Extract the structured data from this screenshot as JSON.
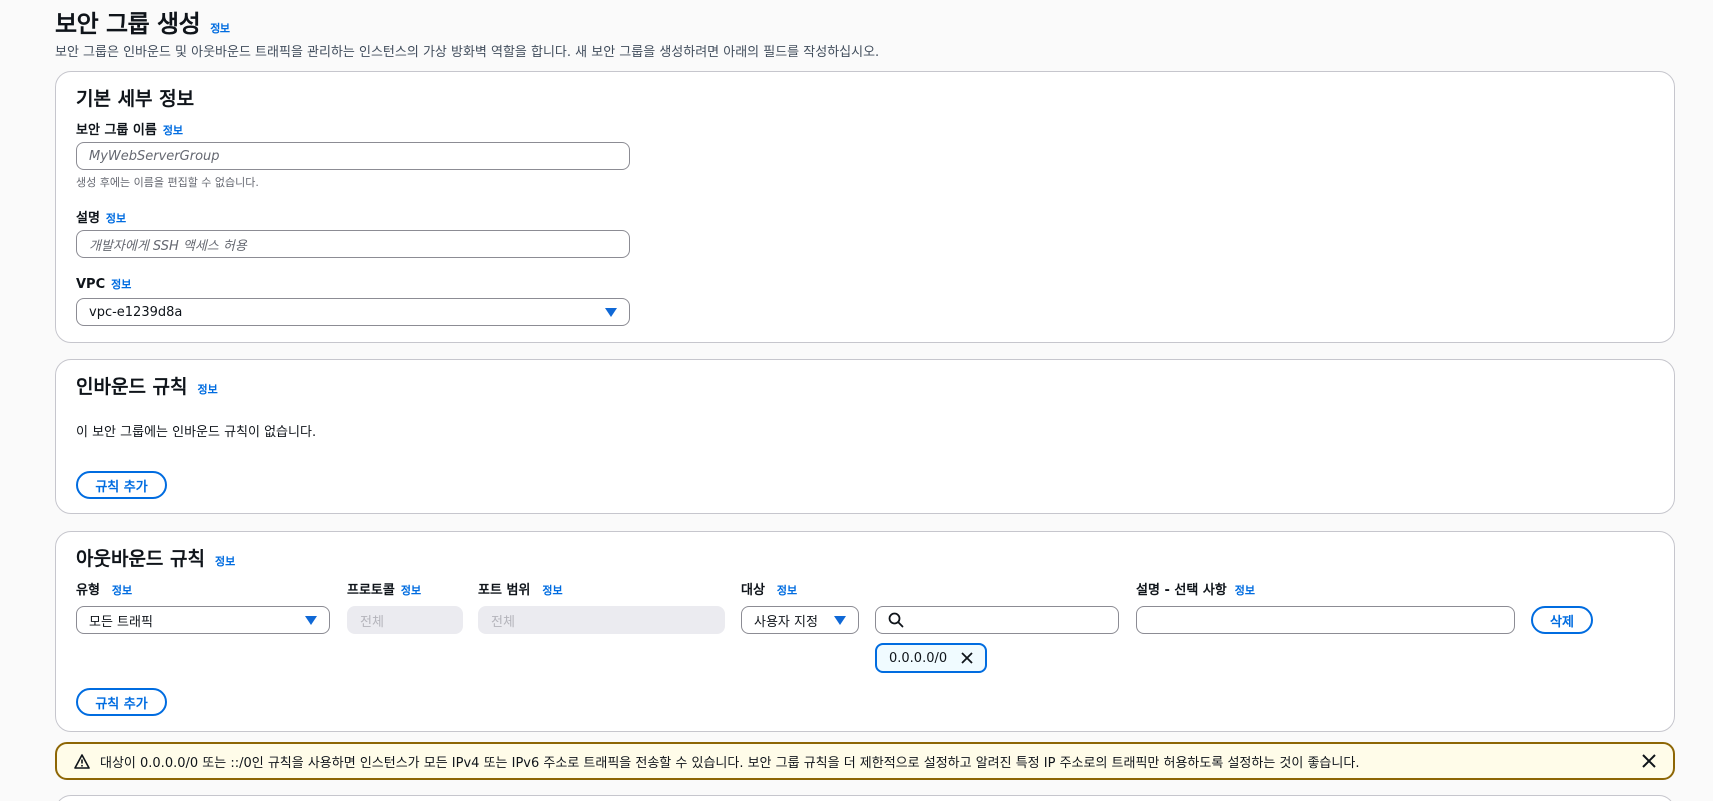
{
  "header": {
    "title": "보안 그룹 생성",
    "info": "정보",
    "description": "보안 그룹은 인바운드 및 아웃바운드 트래픽을 관리하는 인스턴스의 가상 방화벽 역할을 합니다. 새 보안 그룹을 생성하려면 아래의 필드를 작성하십시오."
  },
  "basic": {
    "title": "기본 세부 정보",
    "name_label": "보안 그룹 이름",
    "name_info": "정보",
    "name_placeholder": "MyWebServerGroup",
    "name_hint": "생성 후에는 이름을 편집할 수 없습니다.",
    "desc_label": "설명",
    "desc_info": "정보",
    "desc_placeholder": "개발자에게 SSH 액세스 허용",
    "vpc_label": "VPC",
    "vpc_info": "정보",
    "vpc_value": "vpc-e1239d8a"
  },
  "inbound": {
    "title": "인바운드 규칙",
    "info": "정보",
    "empty_text": "이 보안 그룹에는 인바운드 규칙이 없습니다.",
    "add_rule": "규칙 추가"
  },
  "outbound": {
    "title": "아웃바운드 규칙",
    "info": "정보",
    "col_type": "유형",
    "col_protocol": "프로토콜",
    "col_port": "포트 범위",
    "col_dest": "대상",
    "col_desc": "설명 - 선택 사항",
    "col_info": "정보",
    "type_value": "모든 트래픽",
    "protocol_value": "전체",
    "port_value": "전체",
    "dest_mode": "사용자 지정",
    "dest_token": "0.0.0.0/0",
    "delete": "삭제",
    "add_rule": "규칙 추가"
  },
  "warning": {
    "text": "대상이 0.0.0.0/0 또는 ::/0인 규칙을 사용하면 인스턴스가 모든 IPv4 또는 IPv6 주소로 트래픽을 전송할 수 있습니다. 보안 그룹 규칙을 더 제한적으로 설정하고 알려진 특정 IP 주소로의 트래픽만 허용하도록 설정하는 것이 좋습니다."
  },
  "colors": {
    "accent": "#006ce0",
    "warning_border": "#8d6605",
    "warning_bg": "#fffce9"
  },
  "icons": [
    "warning-icon",
    "close-icon",
    "search-icon",
    "chevron-down-icon",
    "dismiss-token-icon"
  ]
}
